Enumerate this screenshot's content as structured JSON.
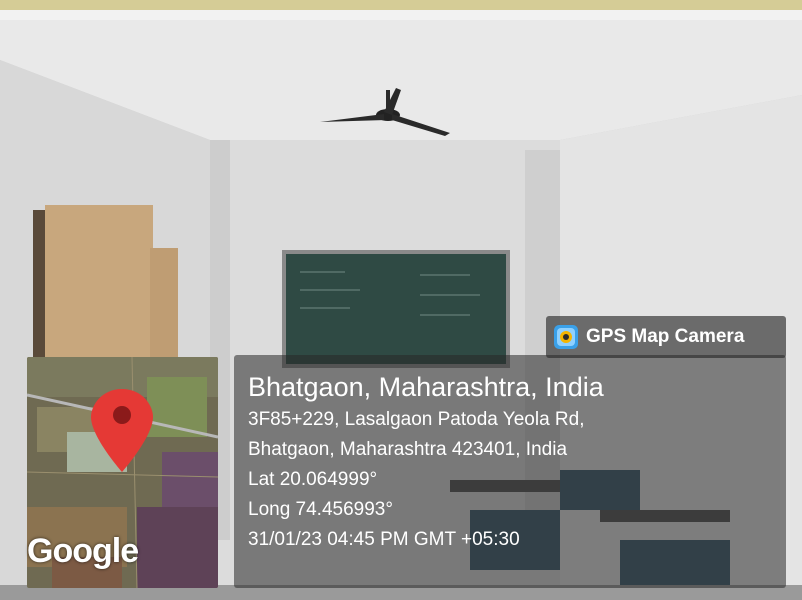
{
  "badge": {
    "label": "GPS Map Camera",
    "icon": "gps-map-camera-logo-icon"
  },
  "map": {
    "attribution": "Google",
    "pin_color": "#e53935"
  },
  "location": {
    "title": "Bhatgaon, Maharashtra, India",
    "address_line1": "3F85+229, Lasalgaon Patoda Yeola Rd,",
    "address_line2": "Bhatgaon, Maharashtra 423401, India",
    "latitude": "Lat 20.064999°",
    "longitude": "Long 74.456993°",
    "timestamp": "31/01/23 04:45 PM GMT +05:30"
  }
}
